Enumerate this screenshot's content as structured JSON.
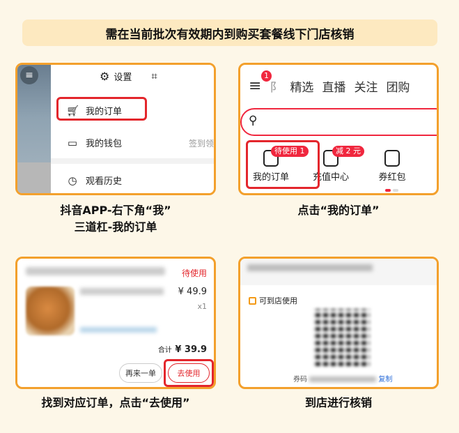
{
  "banner": {
    "title": "需在当前批次有效期内到购买套餐线下门店核销"
  },
  "step1": {
    "caption_line1": "抖音APP-右下角“我”",
    "caption_line2": "三道杠-我的订单",
    "settings_label": "设置",
    "menu_items": [
      "我的订单",
      "我的钱包",
      "观看历史"
    ],
    "wallet_right_text": "签到领"
  },
  "step2": {
    "caption": "点击“我的订单”",
    "notification_count": "1",
    "nav_partial": "阝",
    "nav_tabs": [
      "精选",
      "直播",
      "关注",
      "团购"
    ],
    "items": [
      "我的订单",
      "充值中心",
      "券红包"
    ],
    "pending_badge": "待使用 1",
    "discount_badge": "减 2 元"
  },
  "step3": {
    "caption": "找到对应订单，点击“去使用”",
    "status": "待使用",
    "price": "¥ 49.9",
    "quantity": "x1",
    "total_label": "合计",
    "total_value": "¥ 39.9",
    "btn_again": "再来一单",
    "btn_use": "去使用"
  },
  "step4": {
    "caption": "到店进行核销",
    "usable_label": "可到店使用",
    "code_label": "券码",
    "copy_label": "复制"
  },
  "colors": {
    "accent": "#f3a02c",
    "red": "#e3262c"
  }
}
